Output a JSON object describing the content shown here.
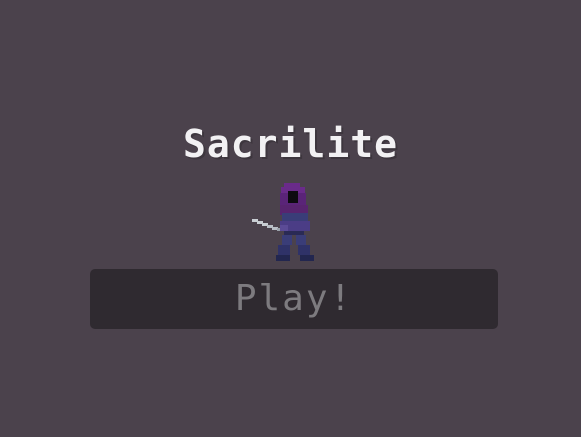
{
  "title": "Sacrilite",
  "character": {
    "icon": "hooded-swordsman-sprite"
  },
  "menu": {
    "play_label": "Play!"
  },
  "colors": {
    "background": "#4b424c",
    "title_text": "#f2f1f3",
    "button_bg": "#2f2a30",
    "button_text": "#7d7b7f",
    "cloak_purple": "#6a2b8a",
    "armor_blue": "#3a3d78",
    "blade": "#c9ced3"
  }
}
